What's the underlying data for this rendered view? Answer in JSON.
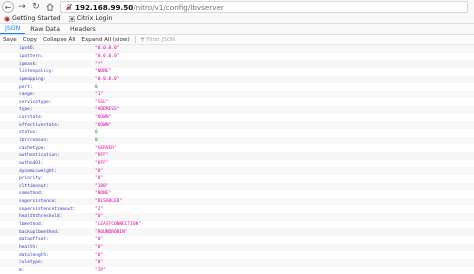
{
  "browser": {
    "url_host": "192.168.99.50",
    "url_path": "/nitro/v1/config/lbvserver",
    "bookmarks": [
      {
        "label": "Getting Started",
        "icon": "firefox-icon"
      },
      {
        "label": "Citrix Login",
        "icon": "citrix-icon"
      }
    ]
  },
  "viewer": {
    "tabs": [
      {
        "label": "JSON",
        "active": true
      },
      {
        "label": "Raw Data",
        "active": false
      },
      {
        "label": "Headers",
        "active": false
      }
    ],
    "toolbar": {
      "save": "Save",
      "copy": "Copy",
      "collapse_all": "Collapse All",
      "expand_all": "Expand All (slow)",
      "filter_placeholder": "Filter JSON"
    }
  },
  "rows": [
    {
      "key": "ipv46:",
      "value": "\"0.0.0.0\"",
      "type": "str"
    },
    {
      "key": "ipattern:",
      "value": "\"0.0.0.0\"",
      "type": "str"
    },
    {
      "key": "ipmask:",
      "value": "\"*\"",
      "type": "str"
    },
    {
      "key": "listenpolicy:",
      "value": "\"NONE\"",
      "type": "str"
    },
    {
      "key": "ipmapping:",
      "value": "\"0.0.0.0\"",
      "type": "str"
    },
    {
      "key": "port:",
      "value": "0",
      "type": "num"
    },
    {
      "key": "range:",
      "value": "\"1\"",
      "type": "str"
    },
    {
      "key": "servicetype:",
      "value": "\"SSL\"",
      "type": "str"
    },
    {
      "key": "type:",
      "value": "\"ADDRESS\"",
      "type": "str"
    },
    {
      "key": "curstate:",
      "value": "\"DOWN\"",
      "type": "str"
    },
    {
      "key": "effectivestate:",
      "value": "\"DOWN\"",
      "type": "str"
    },
    {
      "key": "status:",
      "value": "0",
      "type": "num"
    },
    {
      "key": "lbrrreason:",
      "value": "0",
      "type": "num"
    },
    {
      "key": "cachetype:",
      "value": "\"SERVER\"",
      "type": "str"
    },
    {
      "key": "authentication:",
      "value": "\"OFF\"",
      "type": "str"
    },
    {
      "key": "authn401:",
      "value": "\"OFF\"",
      "type": "str"
    },
    {
      "key": "dynamicweight:",
      "value": "\"0\"",
      "type": "str"
    },
    {
      "key": "priority:",
      "value": "\"0\"",
      "type": "str"
    },
    {
      "key": "clttimeout:",
      "value": "\"180\"",
      "type": "str"
    },
    {
      "key": "somethod:",
      "value": "\"NONE\"",
      "type": "str"
    },
    {
      "key": "sopersistence:",
      "value": "\"DISABLED\"",
      "type": "str"
    },
    {
      "key": "sopersistencetimeout:",
      "value": "\"2\"",
      "type": "str"
    },
    {
      "key": "healththreshold:",
      "value": "\"0\"",
      "type": "str"
    },
    {
      "key": "lbmethod:",
      "value": "\"LEASTCONNECTION\"",
      "type": "str"
    },
    {
      "key": "backuplbmethod:",
      "value": "\"ROUNDROBIN\"",
      "type": "str"
    },
    {
      "key": "dataoffset:",
      "value": "\"0\"",
      "type": "str"
    },
    {
      "key": "health:",
      "value": "\"0\"",
      "type": "str"
    },
    {
      "key": "datalength:",
      "value": "\"0\"",
      "type": "str"
    },
    {
      "key": "ruletype:",
      "value": "\"0\"",
      "type": "str"
    },
    {
      "key": "m:",
      "value": "\"IP\"",
      "type": "str"
    }
  ]
}
